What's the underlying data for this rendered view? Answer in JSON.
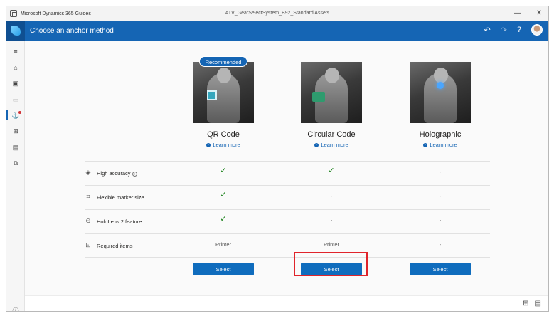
{
  "window": {
    "app_name": "Microsoft Dynamics 365 Guides",
    "doc_name": "ATV_GearSelectSystem_B92_Standard Assets",
    "controls": [
      "—",
      "✕"
    ]
  },
  "header": {
    "title": "Choose an anchor method",
    "undo_icon": "↶",
    "redo_icon": "↷",
    "help_icon": "?"
  },
  "rail": {
    "items": [
      "≡",
      "⌂",
      "▣",
      "▭",
      "⚓",
      "⊞",
      "▤",
      "⧉"
    ],
    "info_icon": "ⓘ"
  },
  "options": [
    {
      "title": "QR Code",
      "learn_more": "Learn more",
      "badge": "Recommended",
      "select": "Select"
    },
    {
      "title": "Circular Code",
      "learn_more": "Learn more",
      "select": "Select"
    },
    {
      "title": "Holographic",
      "learn_more": "Learn more",
      "select": "Select"
    }
  ],
  "rows": [
    {
      "icon": "◈",
      "label": "High accuracy",
      "info_icon": "i",
      "values": [
        "✓",
        "✓",
        "-"
      ]
    },
    {
      "icon": "⌗",
      "label": "Flexible marker size",
      "values": [
        "✓",
        "-",
        "-"
      ]
    },
    {
      "icon": "⊖",
      "label": "HoloLens 2 feature",
      "values": [
        "✓",
        "-",
        "-"
      ]
    },
    {
      "icon": "⊡",
      "label": "Required items",
      "values": [
        "Printer",
        "Printer",
        "-"
      ]
    }
  ],
  "footer": {
    "icons": [
      "⊞",
      "▤"
    ]
  }
}
